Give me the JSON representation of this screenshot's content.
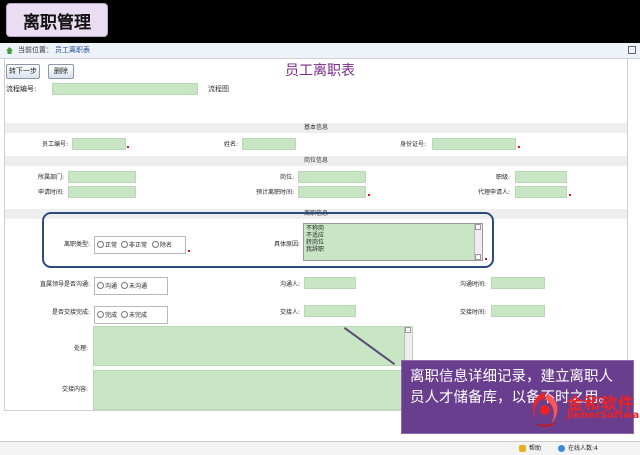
{
  "banner": {
    "title": "离职管理"
  },
  "breadcrumb": {
    "label": "当前位置：",
    "value": "员工离职表"
  },
  "toolbar": {
    "next_step": "转下一步",
    "delete": "删除"
  },
  "flow": {
    "number_label": "流程编号:",
    "number_value": "",
    "flowchart_link": "流程图"
  },
  "form": {
    "title": "员工离职表",
    "basic_section": "基本信息",
    "position_section": "岗位信息",
    "resign_section": "离职信息",
    "employee_no": "员工编号:",
    "name": "姓名:",
    "id_no": "身份证号:",
    "department": "所属部门:",
    "post": "岗位:",
    "job_title": "职级:",
    "apply_time": "申请时间:",
    "expected_time": "预计离职时间:",
    "agent": "代理申请人:",
    "resign_type": "离职类型:",
    "resign_type_options": [
      "正常",
      "非正常",
      "除名"
    ],
    "reason": "具体原因:",
    "reason_options": [
      "不称岗",
      "不适应",
      "转岗位",
      "我辞职"
    ],
    "superior_communicated": "直属领导是否沟通:",
    "communicate_options": [
      "沟通",
      "未沟通"
    ],
    "communicator": "沟通人:",
    "communicate_time": "沟通时间:",
    "handover_done": "是否交接完成:",
    "handover_options": [
      "完成",
      "未完成"
    ],
    "handover_person": "交接人:",
    "handover_time": "交接时间:",
    "handling": "处理:",
    "handover_content": "交接内容:"
  },
  "callout": {
    "text": "离职信息详细记录，建立离职人员人才储备库，以备不时之用。"
  },
  "logo": {
    "cn": "金和软件",
    "en": "JinherSoftware"
  },
  "status": {
    "help": "帮助",
    "online": "在线人数:4"
  },
  "colors": {
    "field_green": "#c8e6c4",
    "title_purple": "#7a2a8a",
    "callout_bg": "#6a3e8f",
    "logo_red": "#e22222"
  }
}
